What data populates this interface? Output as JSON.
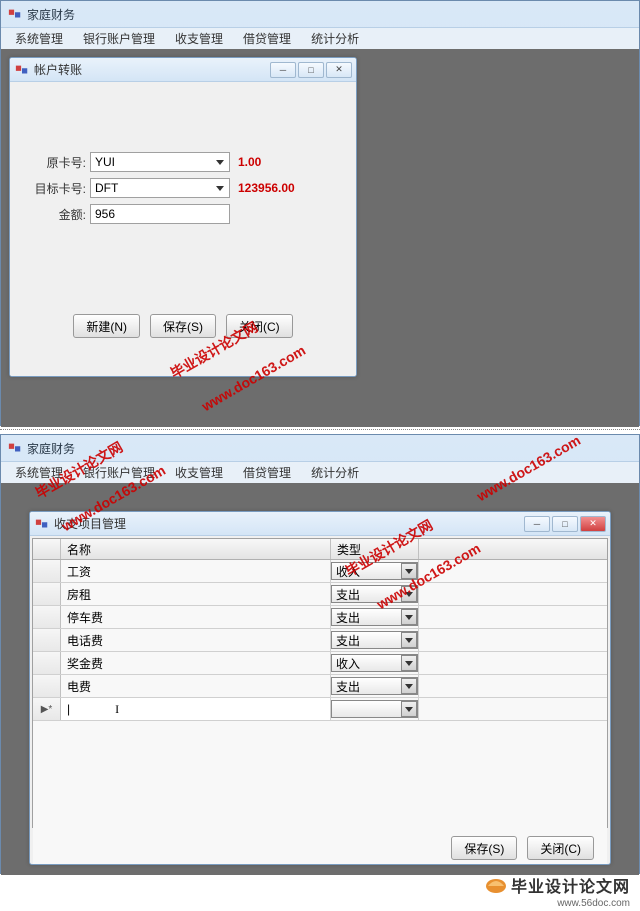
{
  "app1": {
    "title": "家庭财务",
    "menus": [
      "系统管理",
      "银行账户管理",
      "收支管理",
      "借贷管理",
      "统计分析"
    ],
    "child": {
      "title": "帐户转账",
      "labels": {
        "from": "原卡号:",
        "to": "目标卡号:",
        "amount": "金额:"
      },
      "from_value": "YUI",
      "from_balance": "1.00",
      "to_value": "DFT",
      "to_balance": "123956.00",
      "amount_value": "956",
      "buttons": {
        "new": "新建(N)",
        "save": "保存(S)",
        "close": "关闭(C)"
      }
    }
  },
  "app2": {
    "title": "家庭财务",
    "menus": [
      "系统管理",
      "银行账户管理",
      "收支管理",
      "借贷管理",
      "统计分析"
    ],
    "child": {
      "title": "收支项目管理",
      "headers": {
        "name": "名称",
        "type": "类型"
      },
      "rows": [
        {
          "name": "工资",
          "type": "收入"
        },
        {
          "name": "房租",
          "type": "支出"
        },
        {
          "name": "停车费",
          "type": "支出"
        },
        {
          "name": "电话费",
          "type": "支出"
        },
        {
          "name": "奖金费",
          "type": "收入"
        },
        {
          "name": "电费",
          "type": "支出"
        }
      ],
      "new_row_marker": "▶*",
      "buttons": {
        "save": "保存(S)",
        "close": "关闭(C)"
      }
    }
  },
  "watermarks": {
    "text1": "毕业设计论文网",
    "text2": "www.doc163.com"
  },
  "footer": {
    "text": "毕业设计论文网",
    "domain": "www.56doc.com"
  }
}
